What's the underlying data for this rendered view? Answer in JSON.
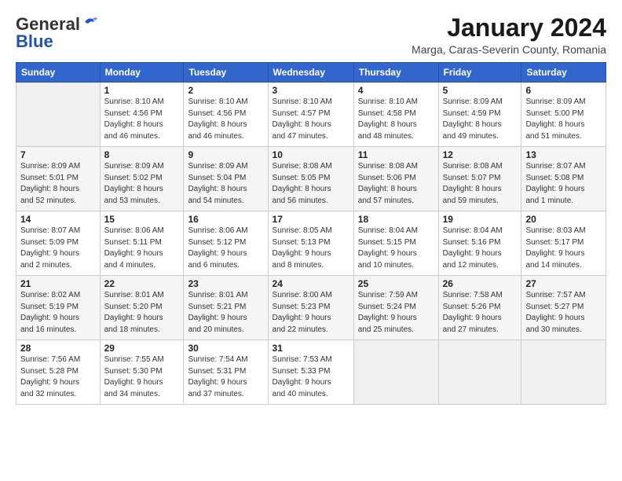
{
  "header": {
    "logo_general": "General",
    "logo_blue": "Blue",
    "month_title": "January 2024",
    "location": "Marga, Caras-Severin County, Romania"
  },
  "weekdays": [
    "Sunday",
    "Monday",
    "Tuesday",
    "Wednesday",
    "Thursday",
    "Friday",
    "Saturday"
  ],
  "weeks": [
    [
      {
        "day": "",
        "info": ""
      },
      {
        "day": "1",
        "info": "Sunrise: 8:10 AM\nSunset: 4:56 PM\nDaylight: 8 hours\nand 46 minutes."
      },
      {
        "day": "2",
        "info": "Sunrise: 8:10 AM\nSunset: 4:56 PM\nDaylight: 8 hours\nand 46 minutes."
      },
      {
        "day": "3",
        "info": "Sunrise: 8:10 AM\nSunset: 4:57 PM\nDaylight: 8 hours\nand 47 minutes."
      },
      {
        "day": "4",
        "info": "Sunrise: 8:10 AM\nSunset: 4:58 PM\nDaylight: 8 hours\nand 48 minutes."
      },
      {
        "day": "5",
        "info": "Sunrise: 8:09 AM\nSunset: 4:59 PM\nDaylight: 8 hours\nand 49 minutes."
      },
      {
        "day": "6",
        "info": "Sunrise: 8:09 AM\nSunset: 5:00 PM\nDaylight: 8 hours\nand 51 minutes."
      }
    ],
    [
      {
        "day": "7",
        "info": "Sunrise: 8:09 AM\nSunset: 5:01 PM\nDaylight: 8 hours\nand 52 minutes."
      },
      {
        "day": "8",
        "info": "Sunrise: 8:09 AM\nSunset: 5:02 PM\nDaylight: 8 hours\nand 53 minutes."
      },
      {
        "day": "9",
        "info": "Sunrise: 8:09 AM\nSunset: 5:04 PM\nDaylight: 8 hours\nand 54 minutes."
      },
      {
        "day": "10",
        "info": "Sunrise: 8:08 AM\nSunset: 5:05 PM\nDaylight: 8 hours\nand 56 minutes."
      },
      {
        "day": "11",
        "info": "Sunrise: 8:08 AM\nSunset: 5:06 PM\nDaylight: 8 hours\nand 57 minutes."
      },
      {
        "day": "12",
        "info": "Sunrise: 8:08 AM\nSunset: 5:07 PM\nDaylight: 8 hours\nand 59 minutes."
      },
      {
        "day": "13",
        "info": "Sunrise: 8:07 AM\nSunset: 5:08 PM\nDaylight: 9 hours\nand 1 minute."
      }
    ],
    [
      {
        "day": "14",
        "info": "Sunrise: 8:07 AM\nSunset: 5:09 PM\nDaylight: 9 hours\nand 2 minutes."
      },
      {
        "day": "15",
        "info": "Sunrise: 8:06 AM\nSunset: 5:11 PM\nDaylight: 9 hours\nand 4 minutes."
      },
      {
        "day": "16",
        "info": "Sunrise: 8:06 AM\nSunset: 5:12 PM\nDaylight: 9 hours\nand 6 minutes."
      },
      {
        "day": "17",
        "info": "Sunrise: 8:05 AM\nSunset: 5:13 PM\nDaylight: 9 hours\nand 8 minutes."
      },
      {
        "day": "18",
        "info": "Sunrise: 8:04 AM\nSunset: 5:15 PM\nDaylight: 9 hours\nand 10 minutes."
      },
      {
        "day": "19",
        "info": "Sunrise: 8:04 AM\nSunset: 5:16 PM\nDaylight: 9 hours\nand 12 minutes."
      },
      {
        "day": "20",
        "info": "Sunrise: 8:03 AM\nSunset: 5:17 PM\nDaylight: 9 hours\nand 14 minutes."
      }
    ],
    [
      {
        "day": "21",
        "info": "Sunrise: 8:02 AM\nSunset: 5:19 PM\nDaylight: 9 hours\nand 16 minutes."
      },
      {
        "day": "22",
        "info": "Sunrise: 8:01 AM\nSunset: 5:20 PM\nDaylight: 9 hours\nand 18 minutes."
      },
      {
        "day": "23",
        "info": "Sunrise: 8:01 AM\nSunset: 5:21 PM\nDaylight: 9 hours\nand 20 minutes."
      },
      {
        "day": "24",
        "info": "Sunrise: 8:00 AM\nSunset: 5:23 PM\nDaylight: 9 hours\nand 22 minutes."
      },
      {
        "day": "25",
        "info": "Sunrise: 7:59 AM\nSunset: 5:24 PM\nDaylight: 9 hours\nand 25 minutes."
      },
      {
        "day": "26",
        "info": "Sunrise: 7:58 AM\nSunset: 5:26 PM\nDaylight: 9 hours\nand 27 minutes."
      },
      {
        "day": "27",
        "info": "Sunrise: 7:57 AM\nSunset: 5:27 PM\nDaylight: 9 hours\nand 30 minutes."
      }
    ],
    [
      {
        "day": "28",
        "info": "Sunrise: 7:56 AM\nSunset: 5:28 PM\nDaylight: 9 hours\nand 32 minutes."
      },
      {
        "day": "29",
        "info": "Sunrise: 7:55 AM\nSunset: 5:30 PM\nDaylight: 9 hours\nand 34 minutes."
      },
      {
        "day": "30",
        "info": "Sunrise: 7:54 AM\nSunset: 5:31 PM\nDaylight: 9 hours\nand 37 minutes."
      },
      {
        "day": "31",
        "info": "Sunrise: 7:53 AM\nSunset: 5:33 PM\nDaylight: 9 hours\nand 40 minutes."
      },
      {
        "day": "",
        "info": ""
      },
      {
        "day": "",
        "info": ""
      },
      {
        "day": "",
        "info": ""
      }
    ]
  ]
}
